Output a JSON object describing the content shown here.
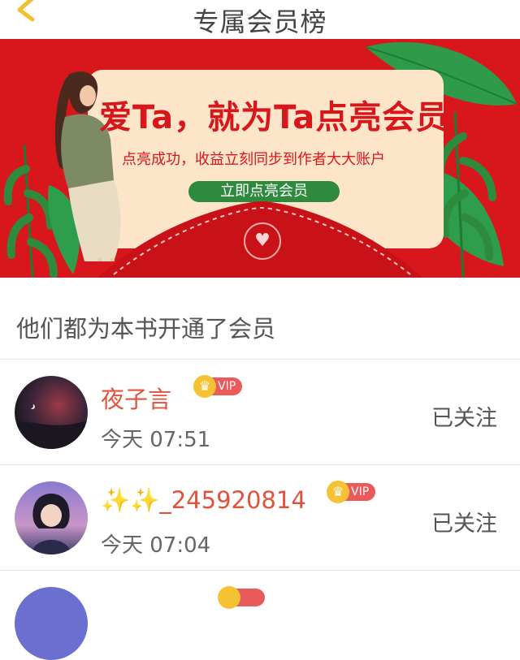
{
  "header": {
    "title": "专属会员榜"
  },
  "banner": {
    "headline": "爱Ta，就为Ta点亮会员",
    "subline": "点亮成功，收益立刻同步到作者大大账户",
    "cta": "立即点亮会员",
    "colors": {
      "background": "#d8171d",
      "card": "#fde5c9",
      "button": "#2e8a3d"
    }
  },
  "section": {
    "title": "他们都为本书开通了会员"
  },
  "members": [
    {
      "name": "夜子言",
      "badge": "VIP",
      "time": "今天 07:51",
      "action": "已关注"
    },
    {
      "name_prefix": "✨✨",
      "name": "_245920814",
      "badge": "VIP",
      "time": "今天 07:04",
      "action": "已关注"
    }
  ],
  "icons": {
    "back": "chevron-left-icon",
    "crown": "crown-icon",
    "heart": "heart-icon"
  },
  "colors": {
    "accent": "#e0533b",
    "vip": "#ea5a5a",
    "crown": "#f4c232"
  }
}
